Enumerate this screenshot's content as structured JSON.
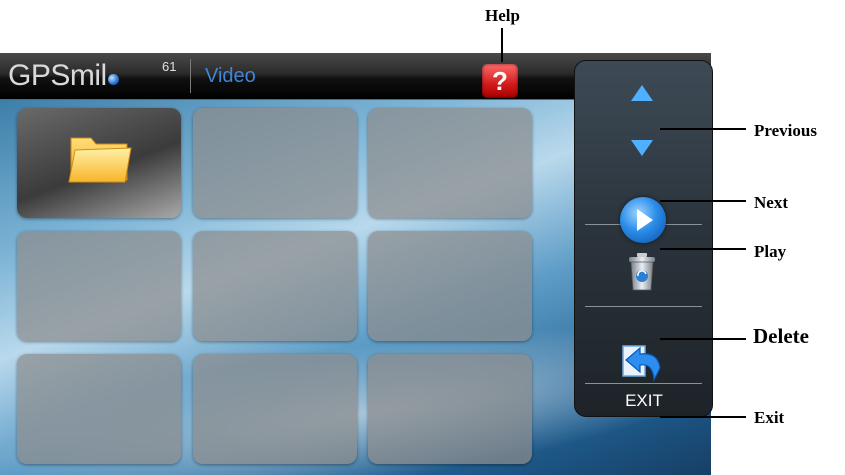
{
  "app": {
    "brand": "GPSmil",
    "brand_superscript": "61",
    "title": "Video"
  },
  "colors": {
    "title_text": "#3f86d8",
    "help_button": "#d11a1a",
    "arrow_blue": "#4fb0ff"
  },
  "help_button": {
    "glyph": "?",
    "icon": "question-icon"
  },
  "grid": {
    "rows": 3,
    "columns": 3,
    "tiles": [
      {
        "content": "folder-icon",
        "selected": true
      },
      {
        "content": "",
        "selected": false
      },
      {
        "content": "",
        "selected": false
      },
      {
        "content": "",
        "selected": false
      },
      {
        "content": "",
        "selected": false
      },
      {
        "content": "",
        "selected": false
      },
      {
        "content": "",
        "selected": false
      },
      {
        "content": "",
        "selected": false
      },
      {
        "content": "",
        "selected": false
      }
    ]
  },
  "side_panel": {
    "previous_icon": "arrow-up-icon",
    "next_icon": "arrow-down-icon",
    "play_icon": "play-icon",
    "delete_icon": "trash-icon",
    "exit_icon": "exit-icon",
    "exit_label": "EXIT"
  },
  "callouts": {
    "help": "Help",
    "previous": "Previous",
    "next": "Next",
    "play": "Play",
    "delete": "Delete",
    "exit": "Exit"
  }
}
